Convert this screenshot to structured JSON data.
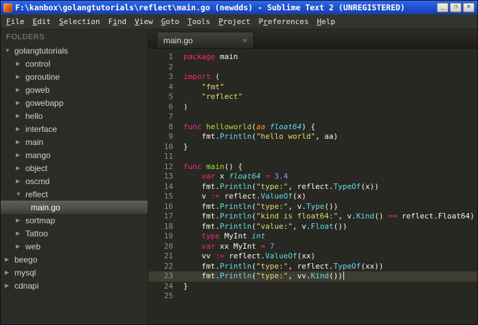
{
  "window": {
    "title": "F:\\kanbox\\golangtutorials\\reflect\\main.go (newdds) - Sublime Text 2 (UNREGISTERED)",
    "controls": {
      "minimize": "_",
      "maximize": "❐",
      "close": "×"
    }
  },
  "menu_bar": {
    "items": [
      {
        "label": "File",
        "accel": 0
      },
      {
        "label": "Edit",
        "accel": 0
      },
      {
        "label": "Selection",
        "accel": 0
      },
      {
        "label": "Find",
        "accel": 1
      },
      {
        "label": "View",
        "accel": 0
      },
      {
        "label": "Goto",
        "accel": 0
      },
      {
        "label": "Tools",
        "accel": 0
      },
      {
        "label": "Project",
        "accel": 0
      },
      {
        "label": "Preferences",
        "accel": 1
      },
      {
        "label": "Help",
        "accel": 0
      }
    ]
  },
  "sidebar": {
    "header": "FOLDERS",
    "items": [
      {
        "label": "golangtutorials",
        "depth": 0,
        "type": "folder",
        "state": "expanded"
      },
      {
        "label": "control",
        "depth": 1,
        "type": "folder",
        "state": "collapsed"
      },
      {
        "label": "goroutine",
        "depth": 1,
        "type": "folder",
        "state": "collapsed"
      },
      {
        "label": "goweb",
        "depth": 1,
        "type": "folder",
        "state": "collapsed"
      },
      {
        "label": "gowebapp",
        "depth": 1,
        "type": "folder",
        "state": "collapsed"
      },
      {
        "label": "hello",
        "depth": 1,
        "type": "folder",
        "state": "collapsed"
      },
      {
        "label": "interface",
        "depth": 1,
        "type": "folder",
        "state": "collapsed"
      },
      {
        "label": "main",
        "depth": 1,
        "type": "folder",
        "state": "collapsed"
      },
      {
        "label": "mango",
        "depth": 1,
        "type": "folder",
        "state": "collapsed"
      },
      {
        "label": "object",
        "depth": 1,
        "type": "folder",
        "state": "collapsed"
      },
      {
        "label": "oscmd",
        "depth": 1,
        "type": "folder",
        "state": "collapsed"
      },
      {
        "label": "reflect",
        "depth": 1,
        "type": "folder",
        "state": "expanded"
      },
      {
        "label": "main.go",
        "depth": 2,
        "type": "file",
        "selected": true
      },
      {
        "label": "sortmap",
        "depth": 1,
        "type": "folder",
        "state": "collapsed"
      },
      {
        "label": "Tattoo",
        "depth": 1,
        "type": "folder",
        "state": "collapsed"
      },
      {
        "label": "web",
        "depth": 1,
        "type": "folder",
        "state": "collapsed"
      },
      {
        "label": "beego",
        "depth": 0,
        "type": "folder",
        "state": "collapsed"
      },
      {
        "label": "mysql",
        "depth": 0,
        "type": "folder",
        "state": "collapsed"
      },
      {
        "label": "cdnapi",
        "depth": 0,
        "type": "folder",
        "state": "collapsed"
      }
    ]
  },
  "tab_bar": {
    "tabs": [
      {
        "label": "main.go",
        "active": true,
        "close_glyph": "×"
      }
    ]
  },
  "editor": {
    "language": "go",
    "active_line": 23,
    "palette": {
      "kw": "#F92672",
      "str": "#E6DB74",
      "fn": "#A6E22E",
      "call": "#66D9EF",
      "typ": "#66D9EF",
      "param": "#FD971F",
      "num": "#AE81FF",
      "plain": "#F8F8F2",
      "lineno": "#8F908A",
      "activeline": "#3E3D32",
      "edbg": "#272822"
    },
    "lines": [
      [
        [
          "k",
          "package"
        ],
        [
          "w",
          " main"
        ]
      ],
      [],
      [
        [
          "k",
          "import"
        ],
        [
          "w",
          " ("
        ]
      ],
      [
        [
          "w",
          "    "
        ],
        [
          "s",
          "\"fmt\""
        ]
      ],
      [
        [
          "w",
          "    "
        ],
        [
          "s",
          "\"reflect\""
        ]
      ],
      [
        [
          "w",
          ")"
        ]
      ],
      [],
      [
        [
          "k",
          "func"
        ],
        [
          "w",
          " "
        ],
        [
          "f",
          "helloworld"
        ],
        [
          "w",
          "("
        ],
        [
          "p",
          "aa"
        ],
        [
          "w",
          " "
        ],
        [
          "t",
          "float64"
        ],
        [
          "w",
          ") {"
        ]
      ],
      [
        [
          "w",
          "    fmt."
        ],
        [
          "c",
          "Println"
        ],
        [
          "w",
          "("
        ],
        [
          "s",
          "\"hello world\""
        ],
        [
          "w",
          ", aa)"
        ]
      ],
      [
        [
          "w",
          "}"
        ]
      ],
      [],
      [
        [
          "k",
          "func"
        ],
        [
          "w",
          " "
        ],
        [
          "f",
          "main"
        ],
        [
          "w",
          "() {"
        ]
      ],
      [
        [
          "w",
          "    "
        ],
        [
          "k",
          "var"
        ],
        [
          "w",
          " x "
        ],
        [
          "t",
          "float64"
        ],
        [
          "w",
          " "
        ],
        [
          "o",
          "="
        ],
        [
          "w",
          " "
        ],
        [
          "n",
          "3.4"
        ]
      ],
      [
        [
          "w",
          "    fmt."
        ],
        [
          "c",
          "Println"
        ],
        [
          "w",
          "("
        ],
        [
          "s",
          "\"type:\""
        ],
        [
          "w",
          ", reflect."
        ],
        [
          "c",
          "TypeOf"
        ],
        [
          "w",
          "(x))"
        ]
      ],
      [
        [
          "w",
          "    v "
        ],
        [
          "o",
          ":="
        ],
        [
          "w",
          " reflect."
        ],
        [
          "c",
          "ValueOf"
        ],
        [
          "w",
          "(x)"
        ]
      ],
      [
        [
          "w",
          "    fmt."
        ],
        [
          "c",
          "Println"
        ],
        [
          "w",
          "("
        ],
        [
          "s",
          "\"type:\""
        ],
        [
          "w",
          ", v."
        ],
        [
          "c",
          "Type"
        ],
        [
          "w",
          "())"
        ]
      ],
      [
        [
          "w",
          "    fmt."
        ],
        [
          "c",
          "Println"
        ],
        [
          "w",
          "("
        ],
        [
          "s",
          "\"kind is float64:\""
        ],
        [
          "w",
          ", v."
        ],
        [
          "c",
          "Kind"
        ],
        [
          "w",
          "() "
        ],
        [
          "o",
          "=="
        ],
        [
          "w",
          " reflect.Float64)"
        ]
      ],
      [
        [
          "w",
          "    fmt."
        ],
        [
          "c",
          "Println"
        ],
        [
          "w",
          "("
        ],
        [
          "s",
          "\"value:\""
        ],
        [
          "w",
          ", v."
        ],
        [
          "c",
          "Float"
        ],
        [
          "w",
          "())"
        ]
      ],
      [
        [
          "w",
          "    "
        ],
        [
          "k",
          "type"
        ],
        [
          "w",
          " MyInt "
        ],
        [
          "t",
          "int"
        ]
      ],
      [
        [
          "w",
          "    "
        ],
        [
          "k",
          "var"
        ],
        [
          "w",
          " xx MyInt "
        ],
        [
          "o",
          "="
        ],
        [
          "w",
          " "
        ],
        [
          "n",
          "7"
        ]
      ],
      [
        [
          "w",
          "    vv "
        ],
        [
          "o",
          ":="
        ],
        [
          "w",
          " reflect."
        ],
        [
          "c",
          "ValueOf"
        ],
        [
          "w",
          "(xx)"
        ]
      ],
      [
        [
          "w",
          "    fmt."
        ],
        [
          "c",
          "Println"
        ],
        [
          "w",
          "("
        ],
        [
          "s",
          "\"type:\""
        ],
        [
          "w",
          ", reflect."
        ],
        [
          "c",
          "TypeOf"
        ],
        [
          "w",
          "(xx))"
        ]
      ],
      [
        [
          "w",
          "    fmt."
        ],
        [
          "c",
          "Println"
        ],
        [
          "w",
          "("
        ],
        [
          "s",
          "\"type:\""
        ],
        [
          "w",
          ", vv."
        ],
        [
          "c",
          "Kind"
        ],
        [
          "w",
          "())"
        ]
      ],
      [
        [
          "w",
          "}"
        ]
      ],
      []
    ]
  }
}
